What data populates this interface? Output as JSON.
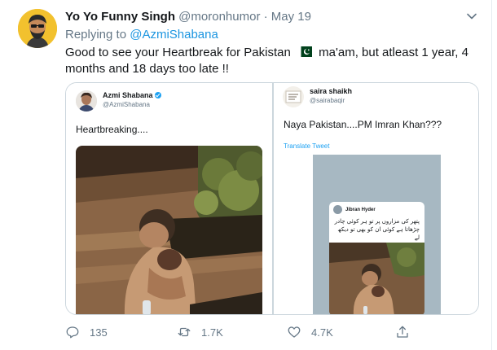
{
  "tweet": {
    "display_name": "Yo Yo Funny Singh",
    "handle": "@moronhumor",
    "separator": "·",
    "date": "May 19",
    "reply_prefix": "Replying to",
    "reply_handle": "@AzmiShabana",
    "text_part1": "Good to see your Heartbreak for Pakistan",
    "flag_icon": "pakistan-flag-icon",
    "text_part2": "ma'am, but atleast 1 year, 4 months and 18 days too late !!"
  },
  "media": {
    "left": {
      "name": "Azmi Shabana",
      "handle": "@AzmiShabana",
      "text": "Heartbreaking...."
    },
    "right": {
      "name": "saira shaikh",
      "handle": "@sairabaqir",
      "text": "Naya Pakistan....PM Imran Khan???",
      "translate": "Translate Tweet",
      "inner": {
        "name": "Jibran Hyder",
        "text": "پتھر کی مزاروں پر تو ہر کوئی چادر چڑھاتا ہے کوئی ان کو بھی تو دیکھ لے"
      }
    }
  },
  "actions": {
    "reply_count": "135",
    "retweet_count": "1.7K",
    "like_count": "4.7K"
  },
  "colors": {
    "accent": "#1b95e0",
    "muted": "#657786",
    "border": "#ccd6dd",
    "text": "#14171a"
  }
}
